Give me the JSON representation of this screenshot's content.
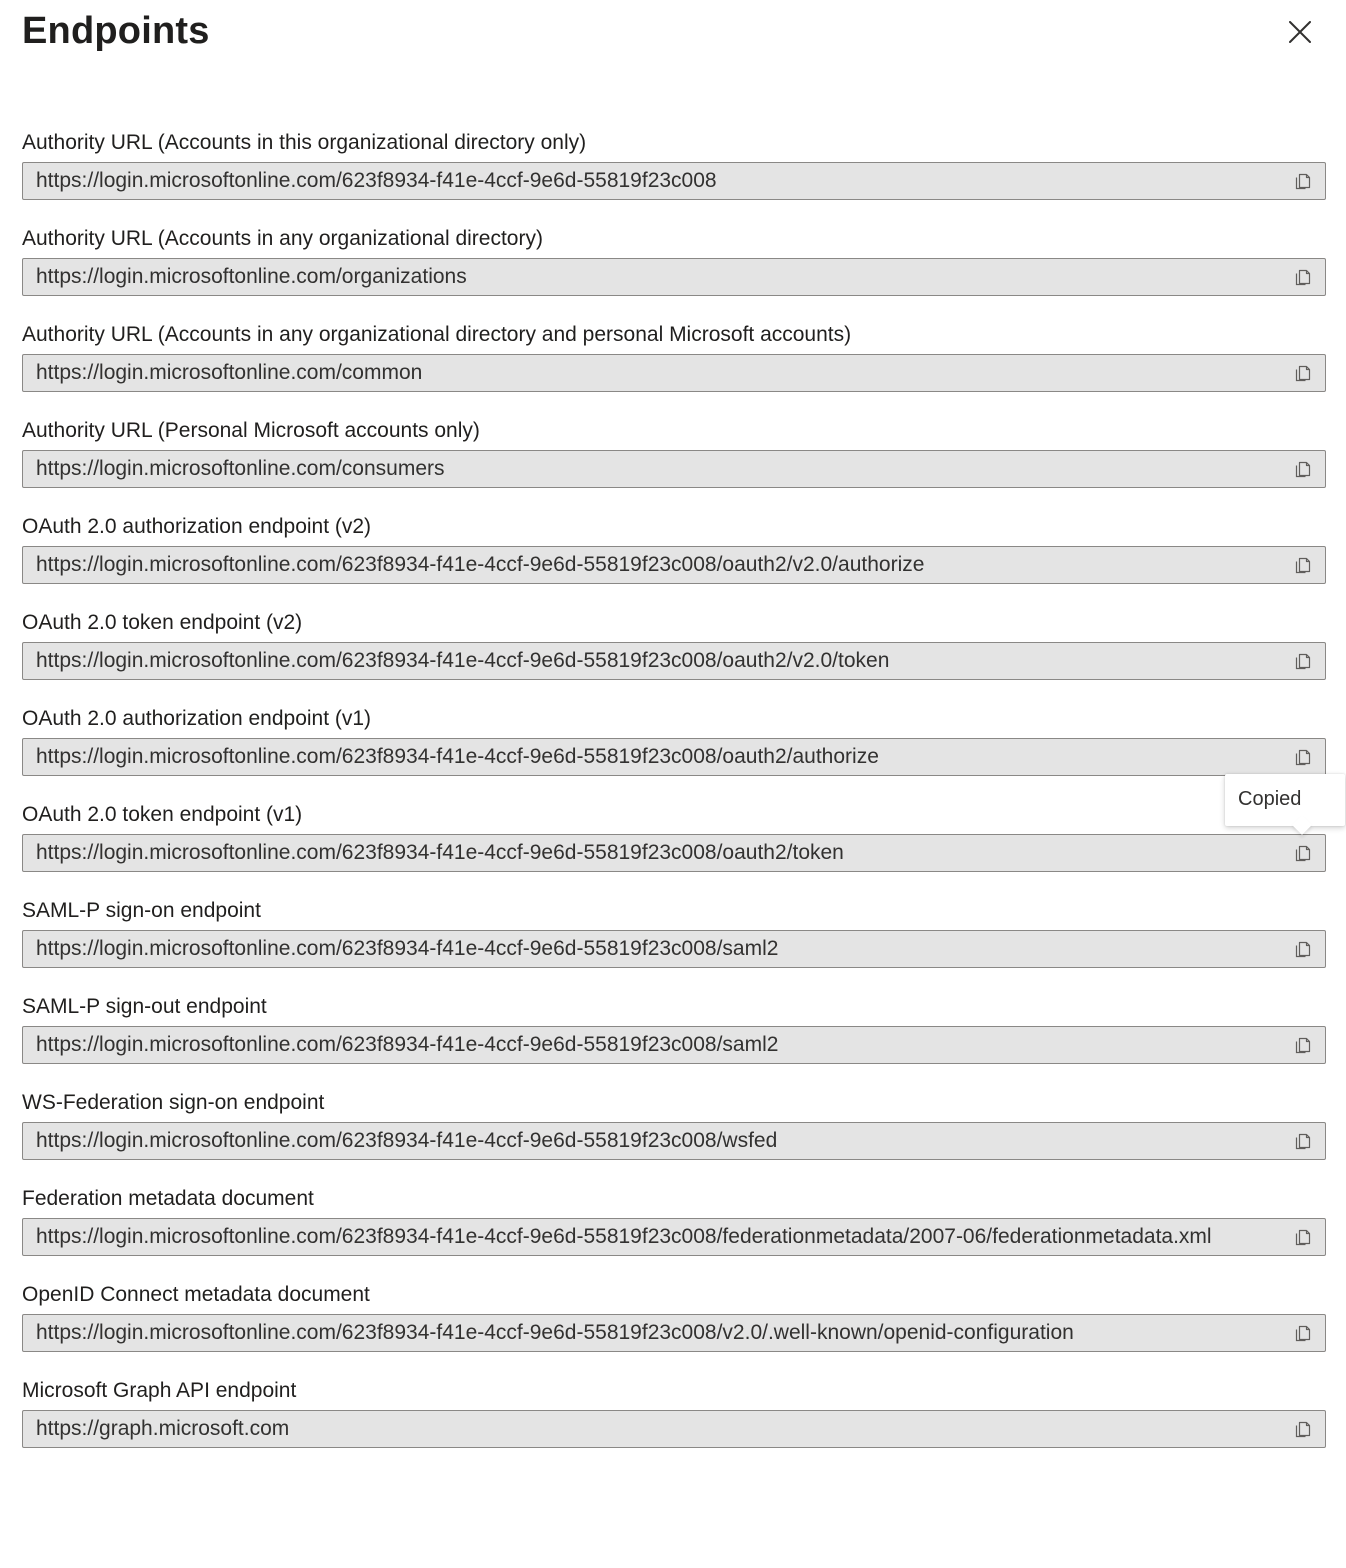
{
  "panel": {
    "title": "Endpoints"
  },
  "tooltip": {
    "text": "Copied"
  },
  "endpoints": [
    {
      "label": "Authority URL (Accounts in this organizational directory only)",
      "value": "https://login.microsoftonline.com/623f8934-f41e-4ccf-9e6d-55819f23c008"
    },
    {
      "label": "Authority URL (Accounts in any organizational directory)",
      "value": "https://login.microsoftonline.com/organizations"
    },
    {
      "label": "Authority URL (Accounts in any organizational directory and personal Microsoft accounts)",
      "value": "https://login.microsoftonline.com/common"
    },
    {
      "label": "Authority URL (Personal Microsoft accounts only)",
      "value": "https://login.microsoftonline.com/consumers"
    },
    {
      "label": "OAuth 2.0 authorization endpoint (v2)",
      "value": "https://login.microsoftonline.com/623f8934-f41e-4ccf-9e6d-55819f23c008/oauth2/v2.0/authorize"
    },
    {
      "label": "OAuth 2.0 token endpoint (v2)",
      "value": "https://login.microsoftonline.com/623f8934-f41e-4ccf-9e6d-55819f23c008/oauth2/v2.0/token"
    },
    {
      "label": "OAuth 2.0 authorization endpoint (v1)",
      "value": "https://login.microsoftonline.com/623f8934-f41e-4ccf-9e6d-55819f23c008/oauth2/authorize"
    },
    {
      "label": "OAuth 2.0 token endpoint (v1)",
      "value": "https://login.microsoftonline.com/623f8934-f41e-4ccf-9e6d-55819f23c008/oauth2/token"
    },
    {
      "label": "SAML-P sign-on endpoint",
      "value": "https://login.microsoftonline.com/623f8934-f41e-4ccf-9e6d-55819f23c008/saml2"
    },
    {
      "label": "SAML-P sign-out endpoint",
      "value": "https://login.microsoftonline.com/623f8934-f41e-4ccf-9e6d-55819f23c008/saml2"
    },
    {
      "label": "WS-Federation sign-on endpoint",
      "value": "https://login.microsoftonline.com/623f8934-f41e-4ccf-9e6d-55819f23c008/wsfed"
    },
    {
      "label": "Federation metadata document",
      "value": "https://login.microsoftonline.com/623f8934-f41e-4ccf-9e6d-55819f23c008/federationmetadata/2007-06/federationmetadata.xml"
    },
    {
      "label": "OpenID Connect metadata document",
      "value": "https://login.microsoftonline.com/623f8934-f41e-4ccf-9e6d-55819f23c008/v2.0/.well-known/openid-configuration"
    },
    {
      "label": "Microsoft Graph API endpoint",
      "value": "https://graph.microsoft.com"
    }
  ],
  "icons": {
    "close": "close-icon",
    "copy": "copy-icon"
  }
}
